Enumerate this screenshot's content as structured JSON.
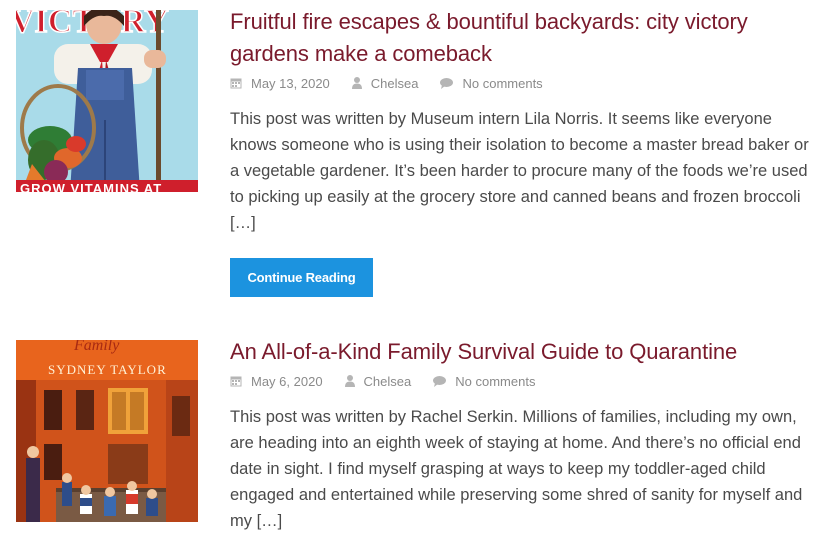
{
  "posts": [
    {
      "title": "Fruitful fire escapes & bountiful backyards: city victory gardens make a comeback",
      "date": "May 13, 2020",
      "author": "Chelsea",
      "comments": "No comments",
      "excerpt": "This post was written by Museum intern Lila Norris. It seems like everyone knows someone who is using their isolation to become a master bread baker or a vegetable gardener. It’s been harder to procure many of the foods we’re used to picking up easily at the grocery store and canned beans and frozen broccoli […]",
      "button_label": "Continue Reading",
      "thumb": {
        "type": "victory-garden-poster",
        "poster_top_text": "VICTORY",
        "poster_bottom_text": "GROW VITAMINS AT",
        "colors": {
          "sky": "#a9dbe9",
          "red": "#cf1f2c",
          "overalls": "#3f5e9a"
        }
      }
    },
    {
      "title": "An All-of-a-Kind Family Survival Guide to Quarantine",
      "date": "May 6, 2020",
      "author": "Chelsea",
      "comments": "No comments",
      "excerpt": "This post was written by Rachel Serkin. Millions of families, including my own, are heading into an eighth week of staying at home. And there’s no official end date in sight. I find myself  grasping at ways to keep my toddler-aged child engaged and entertained while preserving some shred of sanity for myself and my […]",
      "thumb": {
        "type": "book-cover",
        "cover_script": "Family",
        "cover_author": "SYDNEY TAYLOR",
        "colors": {
          "background": "#e8641d",
          "building": "#b8481c"
        }
      }
    }
  ],
  "colors": {
    "title": "#7a1a2c",
    "button": "#1c93df",
    "meta": "#8a8a8a",
    "body_text": "#4a4a4a"
  }
}
